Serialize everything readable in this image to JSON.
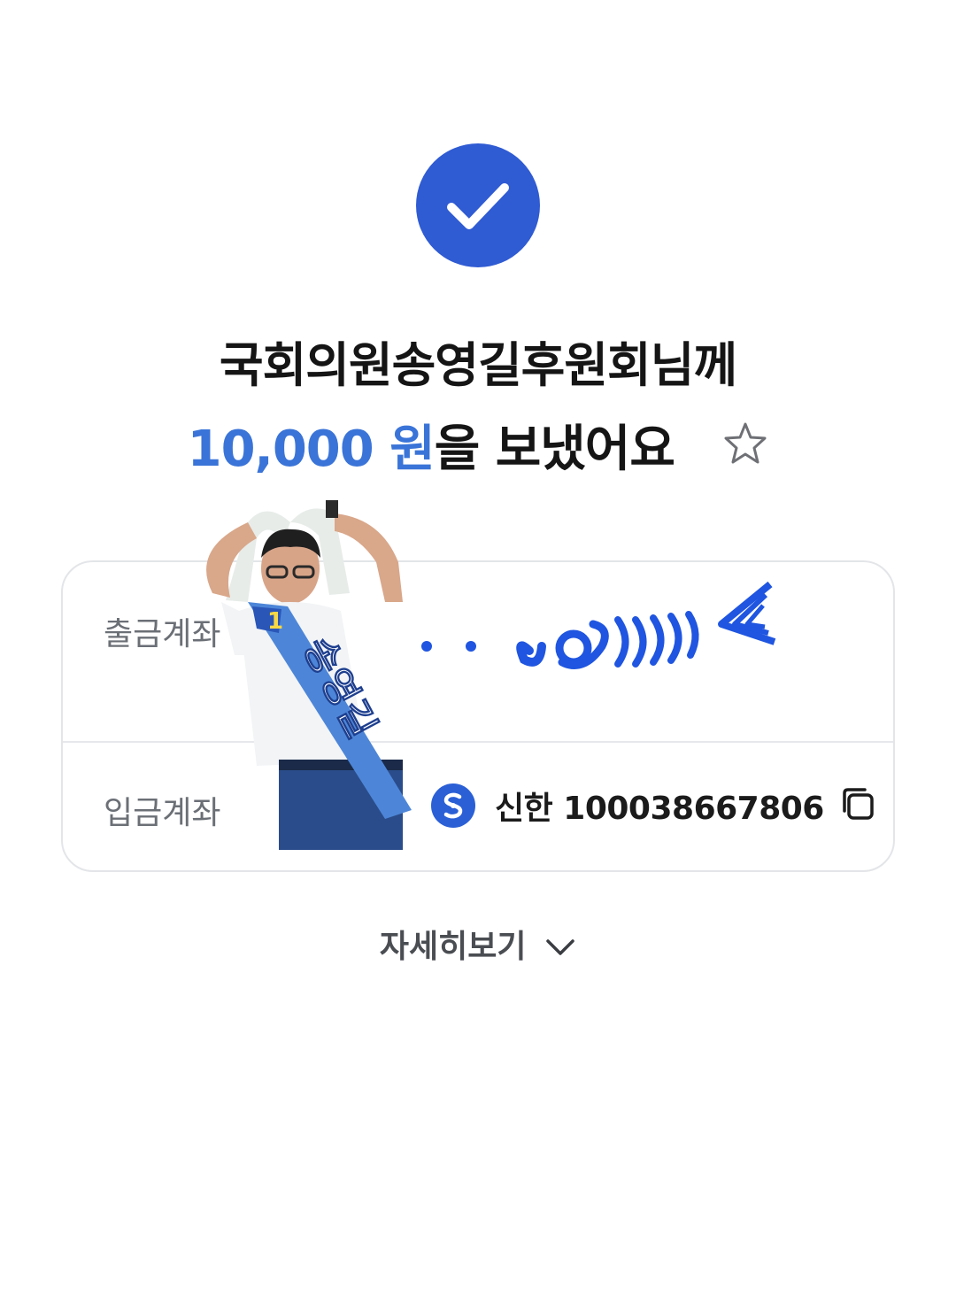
{
  "result": {
    "recipient_line": "국회의원송영길후원회님께",
    "amount": "10,000 원",
    "amount_suffix": "을 보냈어요"
  },
  "details_card": {
    "withdraw_label": "출금계좌",
    "deposit_label": "입금계좌",
    "deposit_account": "신한 100038667806"
  },
  "actions": {
    "more_details": "자세히보기"
  },
  "sticker": {
    "sash_number": "1",
    "sash_name": "송영길"
  },
  "colors": {
    "accent": "#2f5bd3",
    "amount": "#3a74d8",
    "bank_logo": "#2a5fd6",
    "label": "#6b6f76"
  },
  "icons": [
    "check-icon",
    "star-icon",
    "shinhan-logo-icon",
    "copy-icon",
    "chevron-down-icon"
  ]
}
